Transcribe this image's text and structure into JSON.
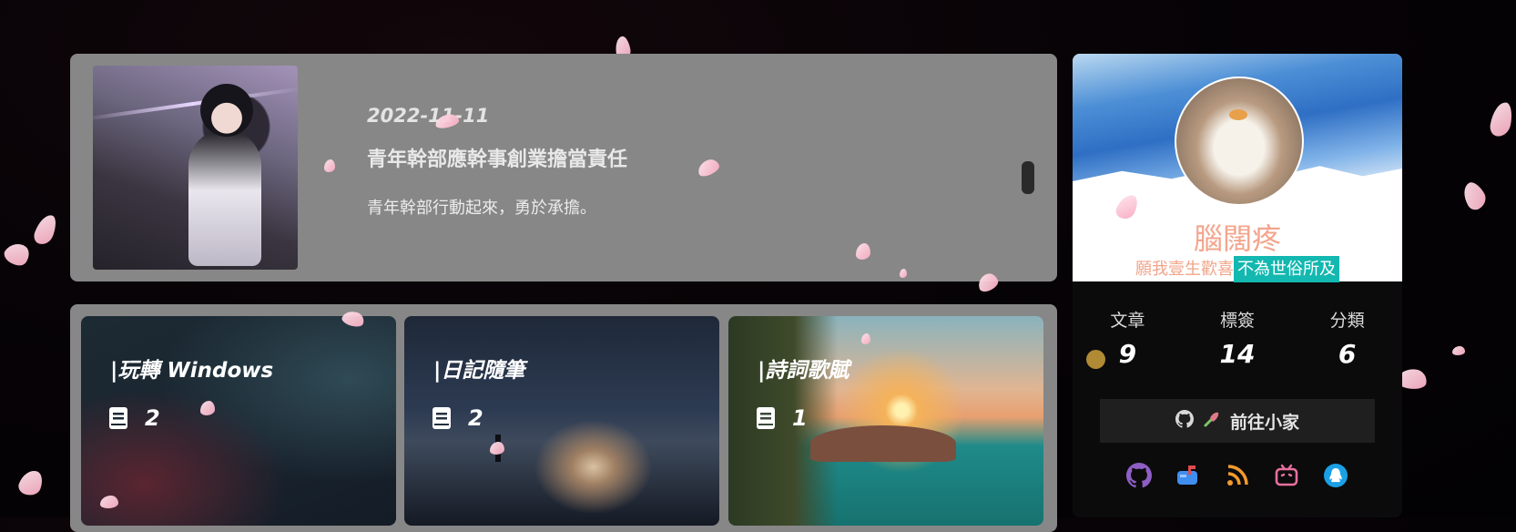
{
  "featured_post": {
    "date": "2022-11-11",
    "title": "青年幹部應幹事創業擔當責任",
    "excerpt": "青年幹部行動起來，勇於承擔。"
  },
  "categories": [
    {
      "name": "|玩轉 Windows",
      "count": "2"
    },
    {
      "name": "|日記隨筆",
      "count": "2"
    },
    {
      "name": "|詩詞歌賦",
      "count": "1"
    }
  ],
  "profile": {
    "name": "腦闊疼",
    "motto_plain": "願我壹生歡喜",
    "motto_highlight": "不為世俗所及",
    "stats": [
      {
        "label": "文章",
        "value": "9"
      },
      {
        "label": "標簽",
        "value": "14"
      },
      {
        "label": "分類",
        "value": "6"
      }
    ],
    "button_label": "前往小家",
    "social_icons": [
      "github-icon",
      "mailbox-icon",
      "rss-icon",
      "bilibili-icon",
      "qq-icon"
    ]
  },
  "colors": {
    "card_bg": "#878787",
    "name_color": "#f3a58d",
    "highlight_bg": "#13b8b0",
    "github": "#8e5ec4",
    "mail": "#3f8ef0",
    "rss": "#f29a2e",
    "bilibili": "#e76f9d",
    "qq": "#1aa0e6"
  }
}
